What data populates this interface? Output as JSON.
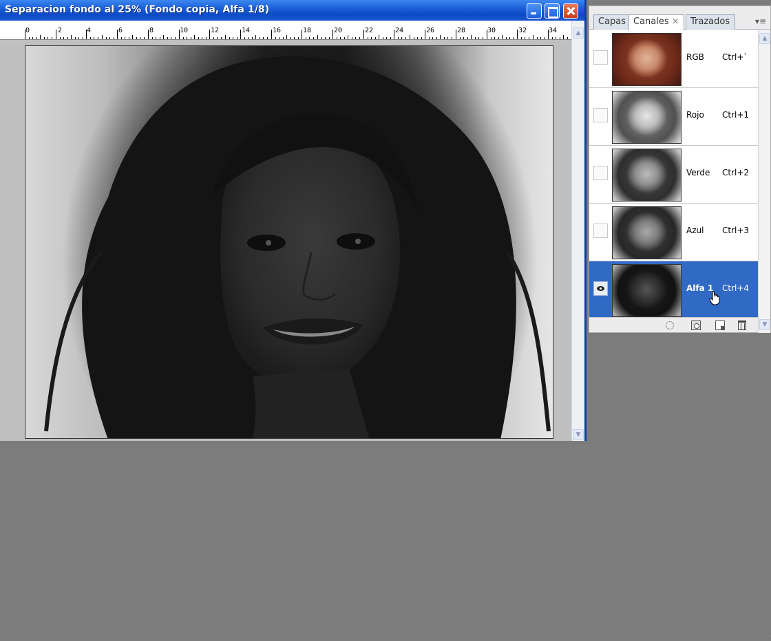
{
  "window": {
    "title": "Separacion fondo al 25% (Fondo copia, Alfa 1/8)"
  },
  "ruler": {
    "labels": [
      "0",
      "2",
      "4",
      "6",
      "8",
      "10",
      "12",
      "14",
      "16",
      "18",
      "20",
      "22",
      "24",
      "26",
      "28",
      "30",
      "32",
      "34"
    ]
  },
  "panel": {
    "tabs": [
      {
        "label": "Capas"
      },
      {
        "label": "Canales"
      },
      {
        "label": "Trazados"
      }
    ],
    "tab_close_glyph": "×",
    "channels": [
      {
        "name": "RGB",
        "shortcut": "Ctrl+`",
        "visible": false,
        "selected": false
      },
      {
        "name": "Rojo",
        "shortcut": "Ctrl+1",
        "visible": false,
        "selected": false
      },
      {
        "name": "Verde",
        "shortcut": "Ctrl+2",
        "visible": false,
        "selected": false
      },
      {
        "name": "Azul",
        "shortcut": "Ctrl+3",
        "visible": false,
        "selected": false
      },
      {
        "name": "Alfa 1",
        "shortcut": "Ctrl+4",
        "visible": true,
        "selected": true
      }
    ]
  },
  "colors": {
    "titlebar": "#0c4bc7",
    "selection": "#316ac5",
    "workspace": "#7c7c7c"
  }
}
